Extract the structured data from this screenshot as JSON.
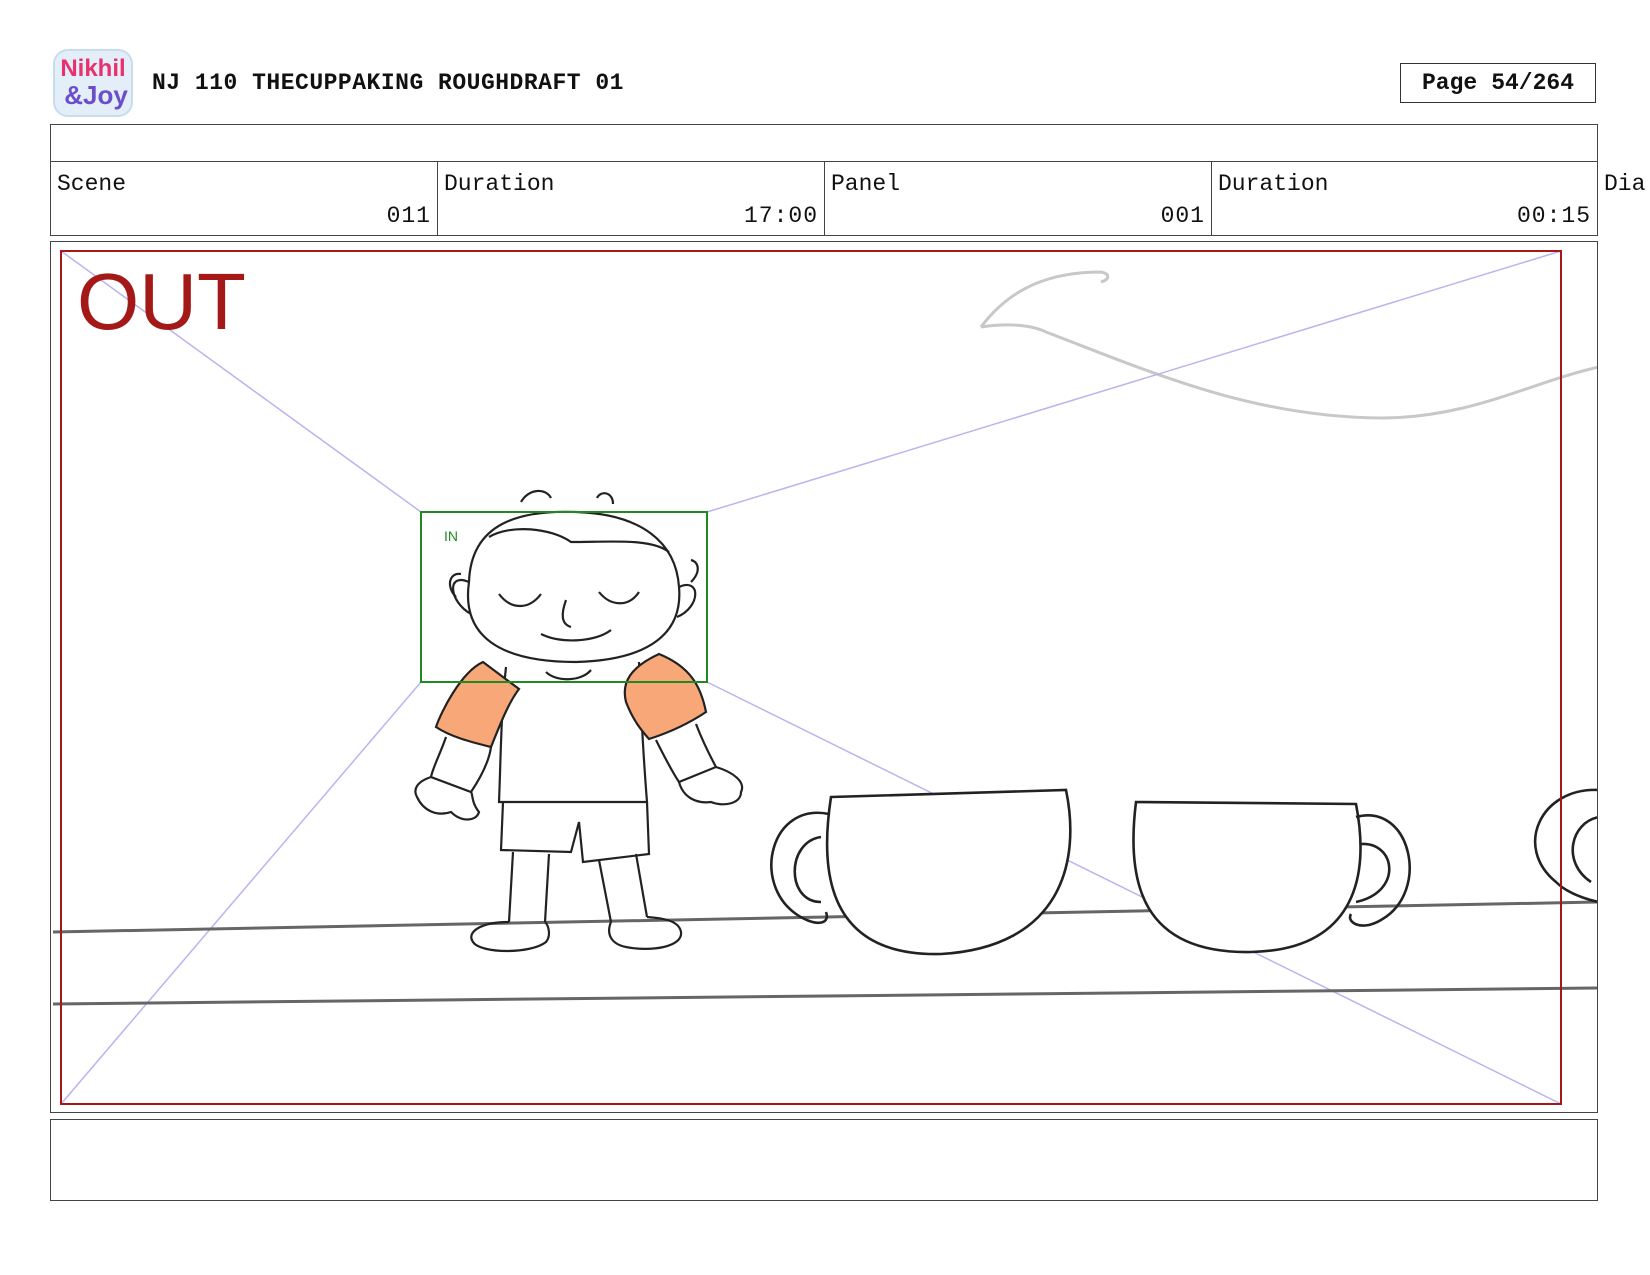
{
  "logo": {
    "text_line1": "Nikhil",
    "text_line2": "&Joy",
    "colors": {
      "nikhil": "#e8326e",
      "joy": "#6a4fc9"
    }
  },
  "header": {
    "title": "NJ 110 THECUPPAKING ROUGHDRAFT 01",
    "page_label": "Page",
    "page_value": "54/264"
  },
  "meta": {
    "scene_label": "Scene",
    "scene_value": "011",
    "duration1_label": "Duration",
    "duration1_value": "17:00",
    "panel_label": "Panel",
    "panel_value": "001",
    "duration2_label": "Duration",
    "duration2_value": "00:15",
    "dialogue_label": "Dia"
  },
  "frame": {
    "out_label": "OUT",
    "in_label": "IN",
    "out_color": "#a51818",
    "in_color": "#1f8a1f",
    "guide_color": "#b9b4f0",
    "shirt_sleeve_color": "#f8a878"
  }
}
